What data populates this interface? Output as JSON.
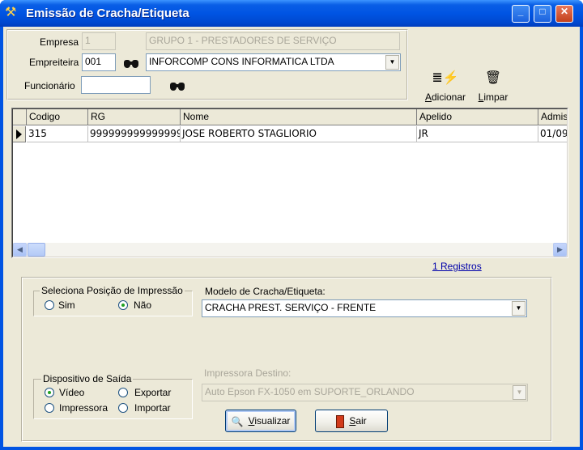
{
  "window": {
    "title": "Emissão de Cracha/Etiqueta",
    "minimize": "_",
    "maximize": "□",
    "close": "✕"
  },
  "filters": {
    "empresa_label": "Empresa",
    "empresa_code": "1",
    "empresa_name": "GRUPO 1 - PRESTADORES DE SERVIÇO",
    "empreiteira_label": "Empreiteira",
    "empreiteira_code": "001",
    "empreiteira_name": "INFORCOMP CONS INFORMATICA LTDA",
    "funcionario_label": "Funcionário",
    "funcionario_value": ""
  },
  "toolbar": {
    "adicionar_first": "A",
    "adicionar_rest": "dicionar",
    "limpar_first": "L",
    "limpar_rest": "impar"
  },
  "grid": {
    "columns": [
      "Codigo",
      "RG",
      "Nome",
      "Apelido",
      "Admis"
    ],
    "rows": [
      [
        "315",
        "999999999999999",
        "JOSE ROBERTO STAGLIORIO",
        "JR",
        "01/09"
      ]
    ],
    "record_count": "1 Registros"
  },
  "print_position": {
    "legend": "Seleciona Posição de Impressão",
    "options": [
      "Sim",
      "Não"
    ],
    "selected": "Não"
  },
  "model": {
    "label": "Modelo de Cracha/Etiqueta:",
    "value": "CRACHA PREST. SERVIÇO - FRENTE"
  },
  "output_device": {
    "legend": "Dispositivo de Saída",
    "options": [
      "Vídeo",
      "Exportar",
      "Impressora",
      "Importar"
    ],
    "selected": "Vídeo"
  },
  "printer": {
    "label": "Impressora Destino:",
    "value": "Auto Epson FX-1050 em SUPORTE_ORLANDO"
  },
  "buttons": {
    "visualizar_first": "V",
    "visualizar_rest": "isualizar",
    "sair_first": "S",
    "sair_rest": "air"
  },
  "colors": {
    "title_bar": "#0054e3",
    "client_bg": "#ece9d8",
    "link": "#0000aa"
  }
}
